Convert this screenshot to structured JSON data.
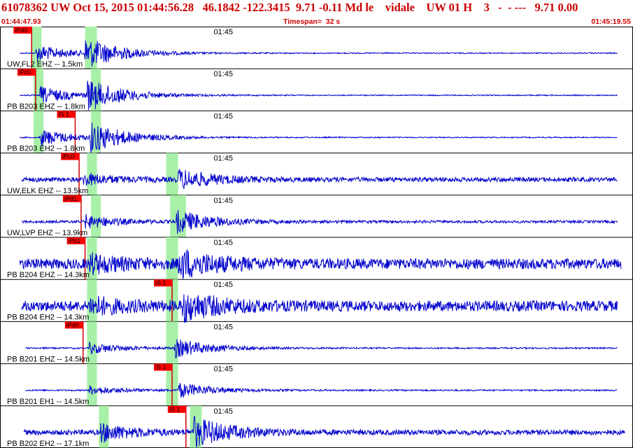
{
  "header": {
    "title": "61078362 UW Oct 15, 2015 01:44:56.28   46.1842 -122.3415  9.71 -0.11 Md le    vidale    UW 01 H    3   -  - ---   9.71 0.00",
    "start_time": "01:44:47.93",
    "timespan": "Timespan=  32 s",
    "end_time": "01:45:19.55"
  },
  "colors": {
    "trace": "#0000cc",
    "pick": "#ff0000",
    "window": "#a8f0a8",
    "header_text": "#cc0000",
    "border": "#000000"
  },
  "chart_data": {
    "type": "line",
    "start": "01:44:47.93",
    "end": "01:45:19.55",
    "timespan_s": 32,
    "time_marker": "01:45",
    "channels": [
      {
        "label": "UW,FL2 EHZ -- 1.5km",
        "pick": "iPd0",
        "pick_t": 1.6,
        "onset_t": 1.8,
        "s_t": 4.3,
        "windows": [
          [
            1.6,
            2.1
          ],
          [
            4.3,
            4.9
          ]
        ],
        "amp": 0.8,
        "noise": 0.03,
        "record": [
          1.0,
          31.2
        ]
      },
      {
        "label": "PB B203 EHZ -- 1.8km",
        "pick": "iPc0",
        "pick_t": 1.8,
        "onset_t": 2.0,
        "s_t": 4.4,
        "windows": [
          [
            1.7,
            2.2
          ],
          [
            4.6,
            5.1
          ]
        ],
        "amp": 0.8,
        "noise": 0.03,
        "record": [
          1.0,
          31.2
        ]
      },
      {
        "label": "PB B203 EH2 -- 1.8km",
        "pick": "iS 1",
        "pick_t": 3.8,
        "onset_t": 2.0,
        "s_t": 4.5,
        "windows": [
          [
            1.7,
            2.2
          ],
          [
            4.6,
            5.1
          ]
        ],
        "amp": 0.8,
        "noise": 0.03,
        "record": [
          1.0,
          31.2
        ]
      },
      {
        "label": "UW,ELK EHZ -- 13.5km",
        "pick": "iPc0",
        "pick_t": 4.0,
        "onset_t": 4.2,
        "s_t": 9.0,
        "windows": [
          [
            4.4,
            4.9
          ],
          [
            8.4,
            9.0
          ]
        ],
        "amp": 0.5,
        "noise": 0.12,
        "record": [
          1.1,
          31.2
        ]
      },
      {
        "label": "UW,LVP EHZ -- 13.9km",
        "pick": "iPd1",
        "pick_t": 4.1,
        "onset_t": 4.3,
        "s_t": 8.9,
        "windows": [
          [
            4.6,
            5.1
          ],
          [
            8.6,
            9.4
          ]
        ],
        "amp": 0.6,
        "noise": 0.07,
        "record": [
          1.1,
          31.2
        ]
      },
      {
        "label": "PB B204 EHZ -- 14.3km",
        "pick": "iPc1",
        "pick_t": 4.3,
        "onset_t": 4.5,
        "s_t": 9.0,
        "windows": [
          [
            4.4,
            4.9
          ],
          [
            8.4,
            9.0
          ]
        ],
        "amp": 0.7,
        "noise": 0.28,
        "record": [
          1.0,
          31.4
        ]
      },
      {
        "label": "PB B204 EH2 -- 14.3km",
        "pick": "iS 1",
        "pick_t": 8.7,
        "onset_t": 4.5,
        "s_t": 9.2,
        "windows": [
          [
            4.4,
            4.9
          ],
          [
            8.4,
            9.0
          ]
        ],
        "amp": 0.7,
        "noise": 0.28,
        "record": [
          1.1,
          31.2
        ]
      },
      {
        "label": "PB B201 EHZ -- 14.5km",
        "pick": "iPd0",
        "pick_t": 4.2,
        "onset_t": 4.5,
        "s_t": 8.8,
        "windows": [
          [
            4.4,
            4.9
          ],
          [
            8.4,
            9.0
          ]
        ],
        "amp": 0.5,
        "noise": 0.04,
        "record": [
          1.3,
          31.2
        ]
      },
      {
        "label": "PB B201 EH1 -- 14.5km",
        "pick": "iS 1",
        "pick_t": 8.7,
        "onset_t": 4.5,
        "s_t": 9.0,
        "windows": [
          [
            4.4,
            4.9
          ],
          [
            8.4,
            9.0
          ]
        ],
        "amp": 0.4,
        "noise": 0.04,
        "record": [
          1.3,
          31.2
        ]
      },
      {
        "label": "PB B202 EH2 -- 17.1km",
        "pick": "iS 1",
        "pick_t": 9.4,
        "onset_t": 5.0,
        "s_t": 9.7,
        "windows": [
          [
            5.0,
            5.5
          ],
          [
            9.6,
            10.2
          ]
        ],
        "amp": 0.8,
        "noise": 0.14,
        "record": [
          1.2,
          31.6
        ]
      }
    ]
  }
}
